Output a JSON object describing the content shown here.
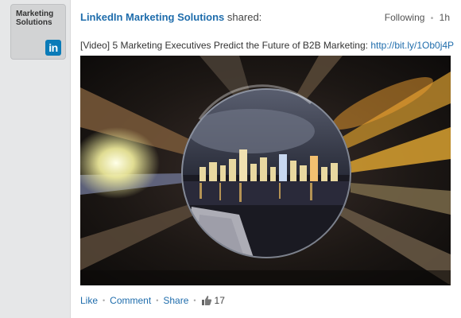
{
  "avatar": {
    "line1": "Marketing",
    "line2": "Solutions",
    "logo_text": "in",
    "logo_color": "#0a7bb8"
  },
  "post": {
    "author": "LinkedIn Marketing Solutions",
    "shared_label": "shared:",
    "following_label": "Following",
    "time": "1h",
    "text": "[Video] 5 Marketing Executives Predict the Future of B2B Marketing:",
    "link": "http://bit.ly/1Ob0j4P",
    "image_icon": "crystal-ball-city-image"
  },
  "actions": {
    "like_label": "Like",
    "comment_label": "Comment",
    "share_label": "Share",
    "like_count": "17",
    "like_icon": "thumbs-up-icon"
  },
  "colors": {
    "link": "#1f6dac",
    "page_background": "#e6e7e8"
  }
}
